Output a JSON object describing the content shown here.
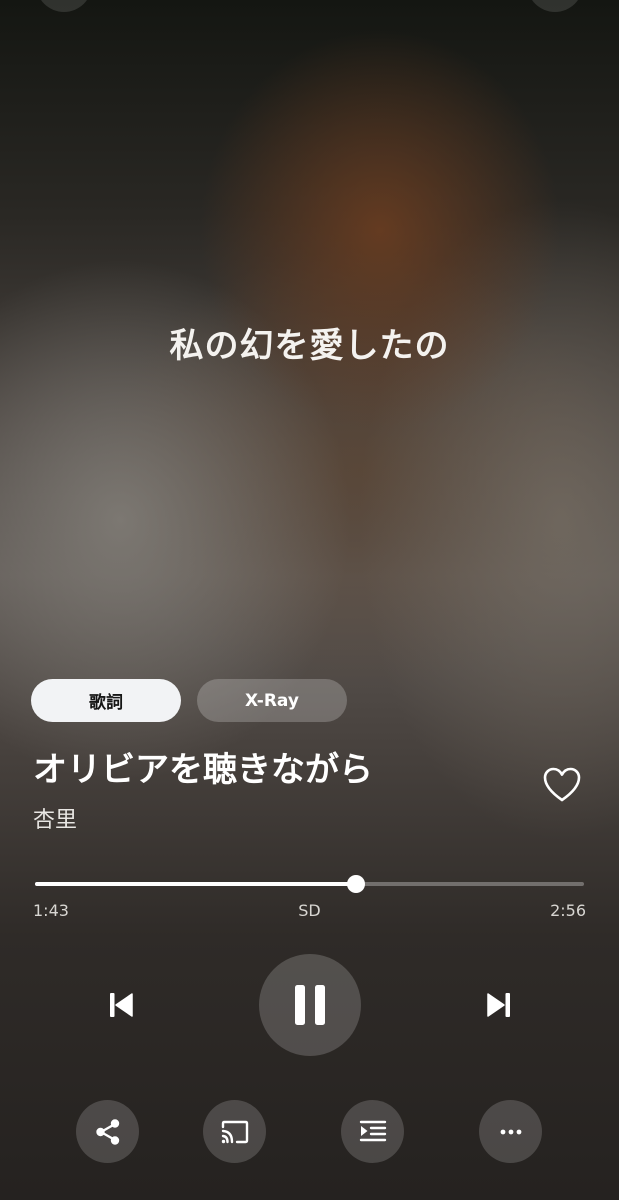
{
  "lyrics": {
    "current_line": "私の幻を愛したの"
  },
  "tabs": [
    {
      "label": "歌詞",
      "active": true
    },
    {
      "label": "X-Ray",
      "active": false
    }
  ],
  "track": {
    "title": "オリビアを聴きながら",
    "artist": "杏里",
    "favorite": false
  },
  "playback": {
    "elapsed": "1:43",
    "total": "2:56",
    "quality": "SD",
    "progress_fraction": 0.585,
    "state": "playing"
  },
  "controls": {
    "previous_icon": "skip-previous-icon",
    "pause_icon": "pause-icon",
    "next_icon": "skip-next-icon"
  },
  "actions": [
    {
      "icon": "share-icon"
    },
    {
      "icon": "cast-icon"
    },
    {
      "icon": "queue-icon"
    },
    {
      "icon": "more-icon"
    }
  ],
  "colors": {
    "tab_active_bg": "#f2f3f5",
    "accent": "#ffffff"
  }
}
